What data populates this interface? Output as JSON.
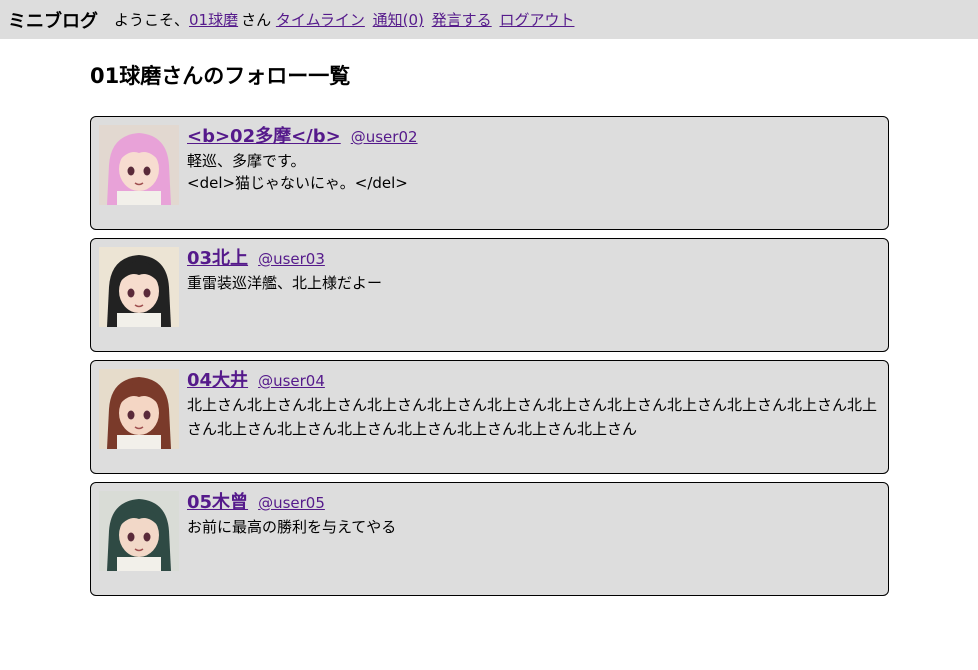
{
  "header": {
    "brand": "ミニブログ",
    "welcome_prefix": "ようこそ、",
    "user_link": "01球磨",
    "welcome_suffix": "さん",
    "nav": [
      "タイムライン",
      "通知(0)",
      "発言する",
      "ログアウト"
    ]
  },
  "page": {
    "title": "01球磨さんのフォロー一覧"
  },
  "follows": [
    {
      "name": "<b>02多摩</b>",
      "handle": "@user02",
      "bio_lines": [
        "軽巡、多摩です。",
        "<del>猫じゃないにゃ。</del>"
      ],
      "avatar_icon": "avatar-pink-hair",
      "hair": "#e8a2d8",
      "skin": "#f7dcd0",
      "bg": "#e2d8d0"
    },
    {
      "name": "03北上",
      "handle": "@user03",
      "bio_lines": [
        "重雷装巡洋艦、北上様だよー"
      ],
      "avatar_icon": "avatar-black-hair",
      "hair": "#222222",
      "skin": "#f6dccd",
      "bg": "#ece4d4"
    },
    {
      "name": "04大井",
      "handle": "@user04",
      "bio_lines": [
        "北上さん北上さん北上さん北上さん北上さん北上さん北上さん北上さん北上さん北上さん北上さん北上さん北上さん北上さん北上さん北上さん北上さん北上さん北上さん"
      ],
      "avatar_icon": "avatar-brown-hair",
      "hair": "#7a3a2a",
      "skin": "#f4d6c4",
      "bg": "#e6dccb"
    },
    {
      "name": "05木曾",
      "handle": "@user05",
      "bio_lines": [
        "お前に最高の勝利を与えてやる"
      ],
      "avatar_icon": "avatar-green-hair",
      "hair": "#2f4a44",
      "skin": "#f2d8c8",
      "bg": "#d9dcd6"
    }
  ]
}
